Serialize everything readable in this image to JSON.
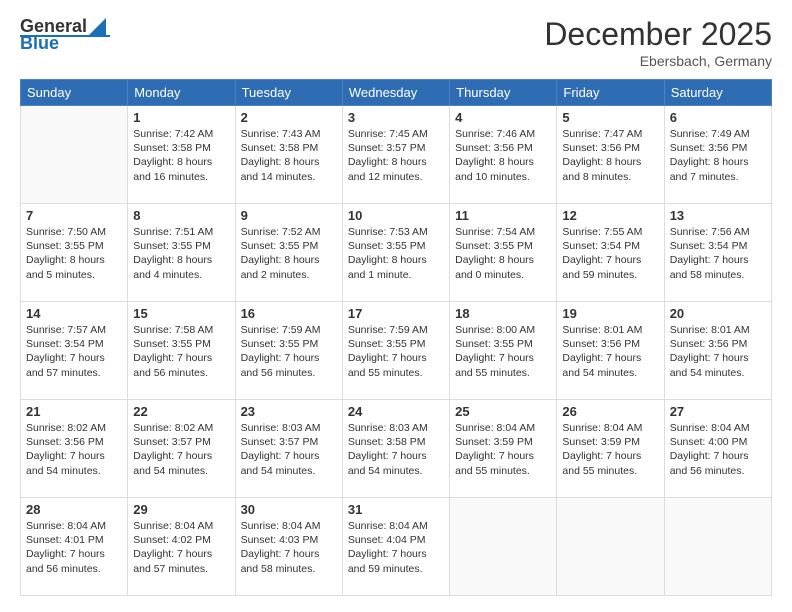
{
  "logo": {
    "general": "General",
    "blue": "Blue"
  },
  "header": {
    "month": "December 2025",
    "location": "Ebersbach, Germany"
  },
  "weekdays": [
    "Sunday",
    "Monday",
    "Tuesday",
    "Wednesday",
    "Thursday",
    "Friday",
    "Saturday"
  ],
  "weeks": [
    [
      {
        "day": "",
        "lines": []
      },
      {
        "day": "1",
        "lines": [
          "Sunrise: 7:42 AM",
          "Sunset: 3:58 PM",
          "Daylight: 8 hours",
          "and 16 minutes."
        ]
      },
      {
        "day": "2",
        "lines": [
          "Sunrise: 7:43 AM",
          "Sunset: 3:58 PM",
          "Daylight: 8 hours",
          "and 14 minutes."
        ]
      },
      {
        "day": "3",
        "lines": [
          "Sunrise: 7:45 AM",
          "Sunset: 3:57 PM",
          "Daylight: 8 hours",
          "and 12 minutes."
        ]
      },
      {
        "day": "4",
        "lines": [
          "Sunrise: 7:46 AM",
          "Sunset: 3:56 PM",
          "Daylight: 8 hours",
          "and 10 minutes."
        ]
      },
      {
        "day": "5",
        "lines": [
          "Sunrise: 7:47 AM",
          "Sunset: 3:56 PM",
          "Daylight: 8 hours",
          "and 8 minutes."
        ]
      },
      {
        "day": "6",
        "lines": [
          "Sunrise: 7:49 AM",
          "Sunset: 3:56 PM",
          "Daylight: 8 hours",
          "and 7 minutes."
        ]
      }
    ],
    [
      {
        "day": "7",
        "lines": [
          "Sunrise: 7:50 AM",
          "Sunset: 3:55 PM",
          "Daylight: 8 hours",
          "and 5 minutes."
        ]
      },
      {
        "day": "8",
        "lines": [
          "Sunrise: 7:51 AM",
          "Sunset: 3:55 PM",
          "Daylight: 8 hours",
          "and 4 minutes."
        ]
      },
      {
        "day": "9",
        "lines": [
          "Sunrise: 7:52 AM",
          "Sunset: 3:55 PM",
          "Daylight: 8 hours",
          "and 2 minutes."
        ]
      },
      {
        "day": "10",
        "lines": [
          "Sunrise: 7:53 AM",
          "Sunset: 3:55 PM",
          "Daylight: 8 hours",
          "and 1 minute."
        ]
      },
      {
        "day": "11",
        "lines": [
          "Sunrise: 7:54 AM",
          "Sunset: 3:55 PM",
          "Daylight: 8 hours",
          "and 0 minutes."
        ]
      },
      {
        "day": "12",
        "lines": [
          "Sunrise: 7:55 AM",
          "Sunset: 3:54 PM",
          "Daylight: 7 hours",
          "and 59 minutes."
        ]
      },
      {
        "day": "13",
        "lines": [
          "Sunrise: 7:56 AM",
          "Sunset: 3:54 PM",
          "Daylight: 7 hours",
          "and 58 minutes."
        ]
      }
    ],
    [
      {
        "day": "14",
        "lines": [
          "Sunrise: 7:57 AM",
          "Sunset: 3:54 PM",
          "Daylight: 7 hours",
          "and 57 minutes."
        ]
      },
      {
        "day": "15",
        "lines": [
          "Sunrise: 7:58 AM",
          "Sunset: 3:55 PM",
          "Daylight: 7 hours",
          "and 56 minutes."
        ]
      },
      {
        "day": "16",
        "lines": [
          "Sunrise: 7:59 AM",
          "Sunset: 3:55 PM",
          "Daylight: 7 hours",
          "and 56 minutes."
        ]
      },
      {
        "day": "17",
        "lines": [
          "Sunrise: 7:59 AM",
          "Sunset: 3:55 PM",
          "Daylight: 7 hours",
          "and 55 minutes."
        ]
      },
      {
        "day": "18",
        "lines": [
          "Sunrise: 8:00 AM",
          "Sunset: 3:55 PM",
          "Daylight: 7 hours",
          "and 55 minutes."
        ]
      },
      {
        "day": "19",
        "lines": [
          "Sunrise: 8:01 AM",
          "Sunset: 3:56 PM",
          "Daylight: 7 hours",
          "and 54 minutes."
        ]
      },
      {
        "day": "20",
        "lines": [
          "Sunrise: 8:01 AM",
          "Sunset: 3:56 PM",
          "Daylight: 7 hours",
          "and 54 minutes."
        ]
      }
    ],
    [
      {
        "day": "21",
        "lines": [
          "Sunrise: 8:02 AM",
          "Sunset: 3:56 PM",
          "Daylight: 7 hours",
          "and 54 minutes."
        ]
      },
      {
        "day": "22",
        "lines": [
          "Sunrise: 8:02 AM",
          "Sunset: 3:57 PM",
          "Daylight: 7 hours",
          "and 54 minutes."
        ]
      },
      {
        "day": "23",
        "lines": [
          "Sunrise: 8:03 AM",
          "Sunset: 3:57 PM",
          "Daylight: 7 hours",
          "and 54 minutes."
        ]
      },
      {
        "day": "24",
        "lines": [
          "Sunrise: 8:03 AM",
          "Sunset: 3:58 PM",
          "Daylight: 7 hours",
          "and 54 minutes."
        ]
      },
      {
        "day": "25",
        "lines": [
          "Sunrise: 8:04 AM",
          "Sunset: 3:59 PM",
          "Daylight: 7 hours",
          "and 55 minutes."
        ]
      },
      {
        "day": "26",
        "lines": [
          "Sunrise: 8:04 AM",
          "Sunset: 3:59 PM",
          "Daylight: 7 hours",
          "and 55 minutes."
        ]
      },
      {
        "day": "27",
        "lines": [
          "Sunrise: 8:04 AM",
          "Sunset: 4:00 PM",
          "Daylight: 7 hours",
          "and 56 minutes."
        ]
      }
    ],
    [
      {
        "day": "28",
        "lines": [
          "Sunrise: 8:04 AM",
          "Sunset: 4:01 PM",
          "Daylight: 7 hours",
          "and 56 minutes."
        ]
      },
      {
        "day": "29",
        "lines": [
          "Sunrise: 8:04 AM",
          "Sunset: 4:02 PM",
          "Daylight: 7 hours",
          "and 57 minutes."
        ]
      },
      {
        "day": "30",
        "lines": [
          "Sunrise: 8:04 AM",
          "Sunset: 4:03 PM",
          "Daylight: 7 hours",
          "and 58 minutes."
        ]
      },
      {
        "day": "31",
        "lines": [
          "Sunrise: 8:04 AM",
          "Sunset: 4:04 PM",
          "Daylight: 7 hours",
          "and 59 minutes."
        ]
      },
      {
        "day": "",
        "lines": []
      },
      {
        "day": "",
        "lines": []
      },
      {
        "day": "",
        "lines": []
      }
    ]
  ]
}
